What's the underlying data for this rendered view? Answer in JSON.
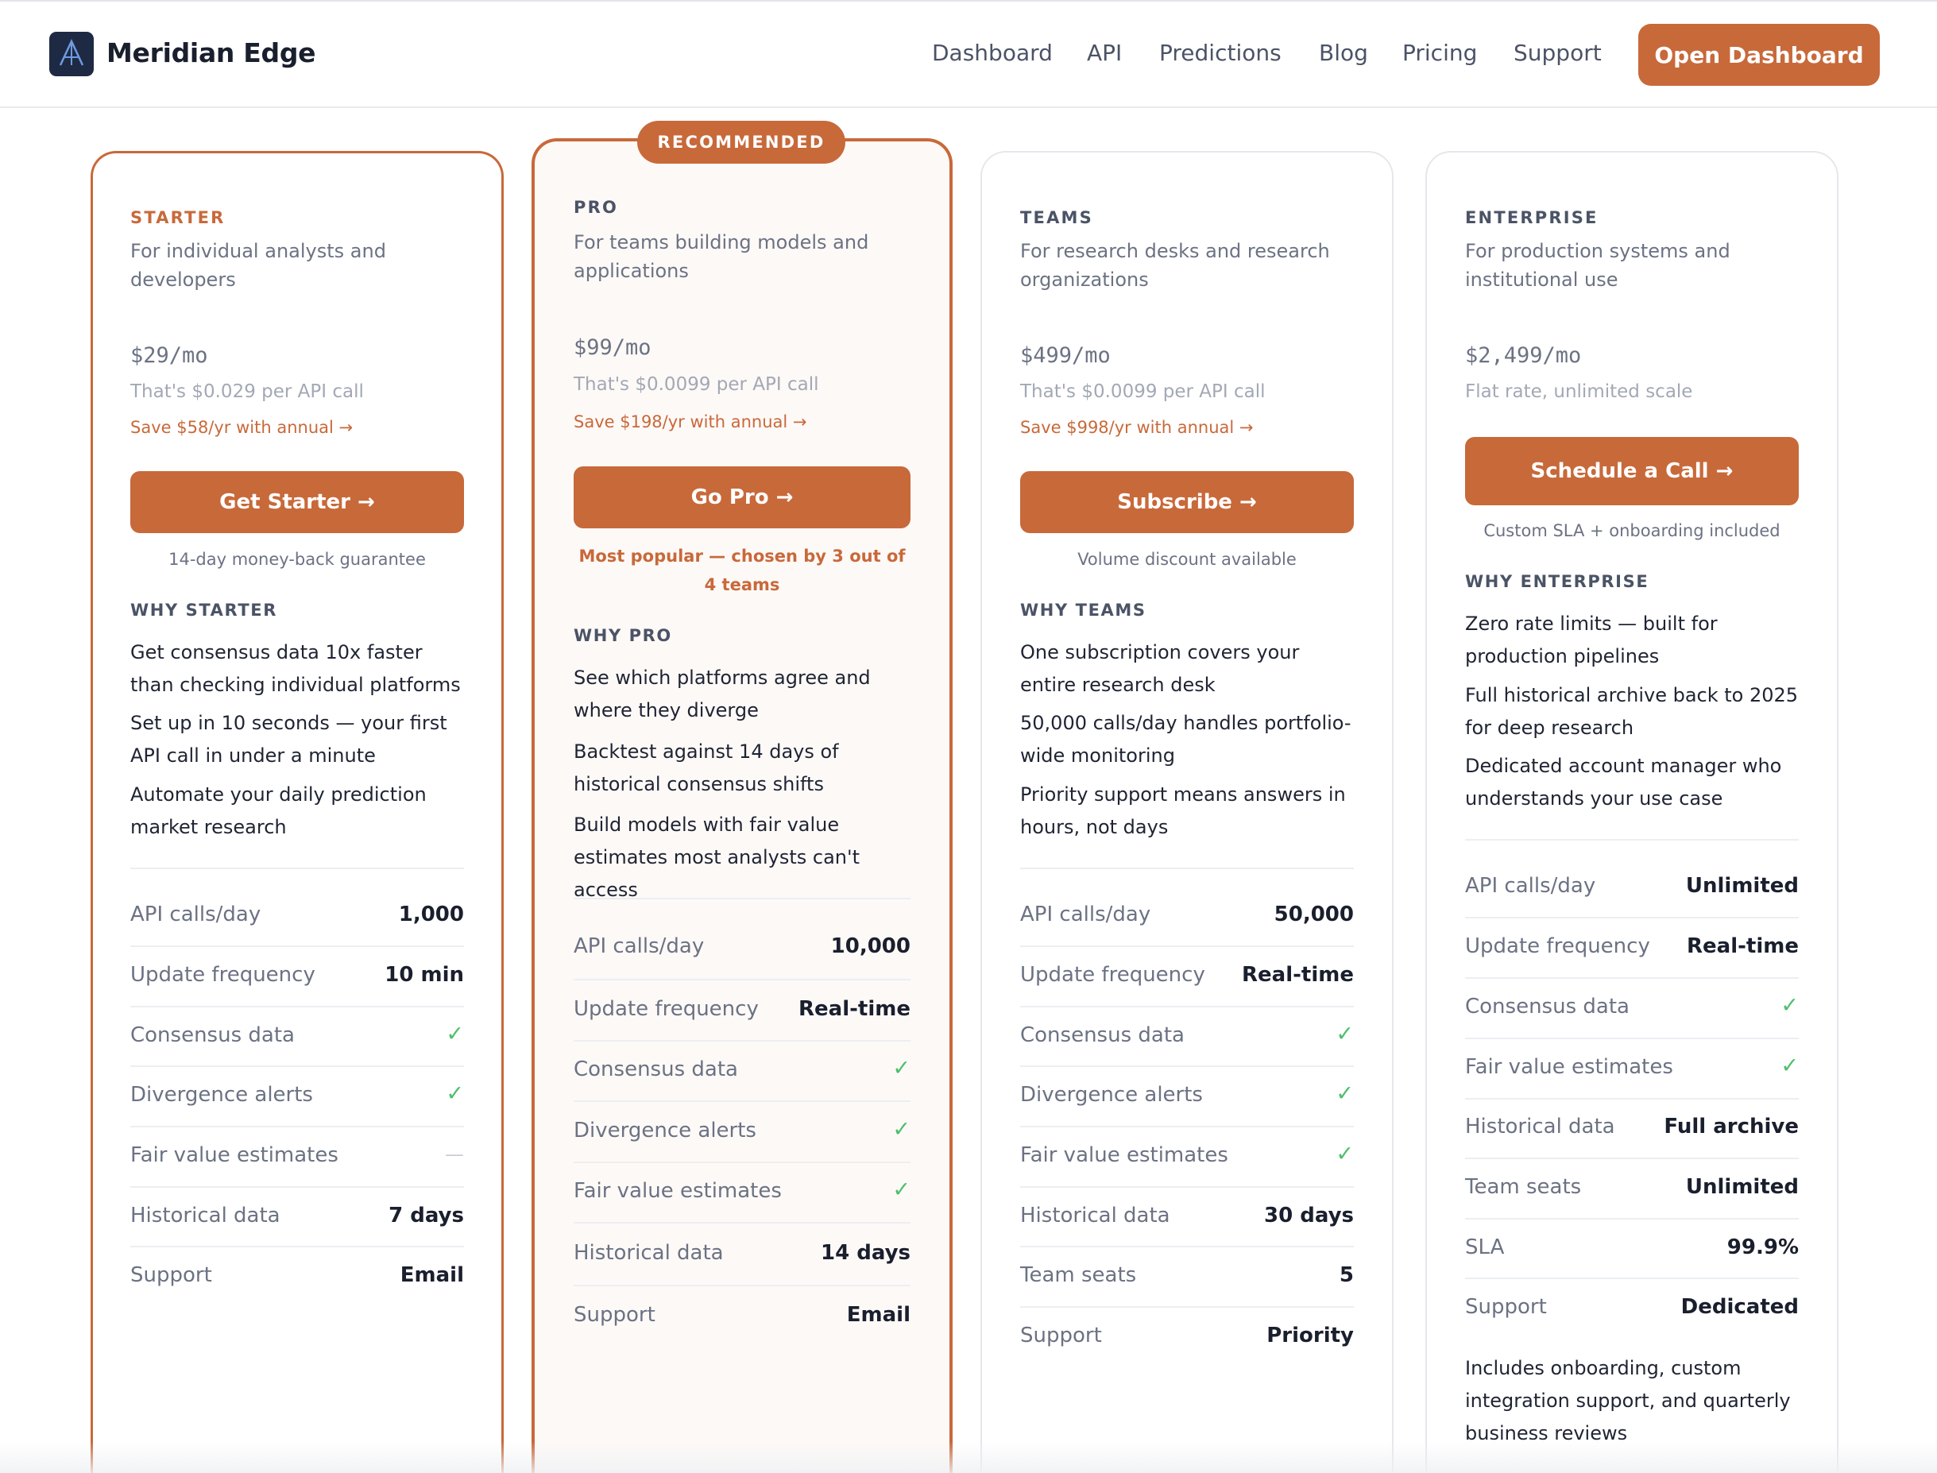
{
  "brand": {
    "name": "Meridian Edge"
  },
  "nav": {
    "items": [
      "Dashboard",
      "API",
      "Predictions",
      "Blog",
      "Pricing",
      "Support"
    ],
    "cta": "Open Dashboard"
  },
  "badge": "RECOMMENDED",
  "plans": [
    {
      "tier": "STARTER",
      "desc": "For individual analysts and developers",
      "price": "$29/mo",
      "per_call": "That's $0.029 per API call",
      "save": "Save $58/yr with annual →",
      "button": "Get Starter →",
      "note": "14-day money-back guarantee",
      "why": "WHY STARTER",
      "benefits": [
        "Get consensus data 10x faster than checking individual platforms",
        "Set up in 10 seconds — your first API call in under a minute",
        "Automate your daily prediction market research"
      ],
      "features": [
        {
          "label": "API calls/day",
          "value": "1,000"
        },
        {
          "label": "Update frequency",
          "value": "10 min"
        },
        {
          "label": "Consensus data",
          "value": "✓"
        },
        {
          "label": "Divergence alerts",
          "value": "✓"
        },
        {
          "label": "Fair value estimates",
          "value": "—"
        },
        {
          "label": "Historical data",
          "value": "7 days"
        },
        {
          "label": "Support",
          "value": "Email"
        }
      ]
    },
    {
      "tier": "PRO",
      "desc": "For teams building models and applications",
      "price": "$99/mo",
      "per_call": "That's $0.0099 per API call",
      "save": "Save $198/yr with annual →",
      "button": "Go Pro →",
      "note": "Most popular — chosen by 3 out of 4 teams",
      "why": "WHY PRO",
      "benefits": [
        "See which platforms agree and where they diverge",
        "Backtest against 14 days of historical consensus shifts",
        "Build models with fair value estimates most analysts can't access"
      ],
      "features": [
        {
          "label": "API calls/day",
          "value": "10,000"
        },
        {
          "label": "Update frequency",
          "value": "Real-time"
        },
        {
          "label": "Consensus data",
          "value": "✓"
        },
        {
          "label": "Divergence alerts",
          "value": "✓"
        },
        {
          "label": "Fair value estimates",
          "value": "✓"
        },
        {
          "label": "Historical data",
          "value": "14 days"
        },
        {
          "label": "Support",
          "value": "Email"
        }
      ]
    },
    {
      "tier": "TEAMS",
      "desc": "For research desks and research organizations",
      "price": "$499/mo",
      "per_call": "That's $0.0099 per API call",
      "save": "Save $998/yr with annual →",
      "button": "Subscribe →",
      "note": "Volume discount available",
      "why": "WHY TEAMS",
      "benefits": [
        "One subscription covers your entire research desk",
        "50,000 calls/day handles portfolio-wide monitoring",
        "Priority support means answers in hours, not days"
      ],
      "features": [
        {
          "label": "API calls/day",
          "value": "50,000"
        },
        {
          "label": "Update frequency",
          "value": "Real-time"
        },
        {
          "label": "Consensus data",
          "value": "✓"
        },
        {
          "label": "Divergence alerts",
          "value": "✓"
        },
        {
          "label": "Fair value estimates",
          "value": "✓"
        },
        {
          "label": "Historical data",
          "value": "30 days"
        },
        {
          "label": "Team seats",
          "value": "5"
        },
        {
          "label": "Support",
          "value": "Priority"
        }
      ]
    },
    {
      "tier": "ENTERPRISE",
      "desc": "For production systems and institutional use",
      "price": "$2,499/mo",
      "per_call": "Flat rate, unlimited scale",
      "button": "Schedule a Call →",
      "note": "Custom SLA + onboarding included",
      "why": "WHY ENTERPRISE",
      "benefits": [
        "Zero rate limits — built for production pipelines",
        "Full historical archive back to 2025 for deep research",
        "Dedicated account manager who understands your use case"
      ],
      "features": [
        {
          "label": "API calls/day",
          "value": "Unlimited"
        },
        {
          "label": "Update frequency",
          "value": "Real-time"
        },
        {
          "label": "Consensus data",
          "value": "✓"
        },
        {
          "label": "Fair value estimates",
          "value": "✓"
        },
        {
          "label": "Historical data",
          "value": "Full archive"
        },
        {
          "label": "Team seats",
          "value": "Unlimited"
        },
        {
          "label": "SLA",
          "value": "99.9%"
        },
        {
          "label": "Support",
          "value": "Dedicated"
        }
      ],
      "footer": "Includes onboarding, custom integration support, and quarterly business reviews"
    }
  ]
}
